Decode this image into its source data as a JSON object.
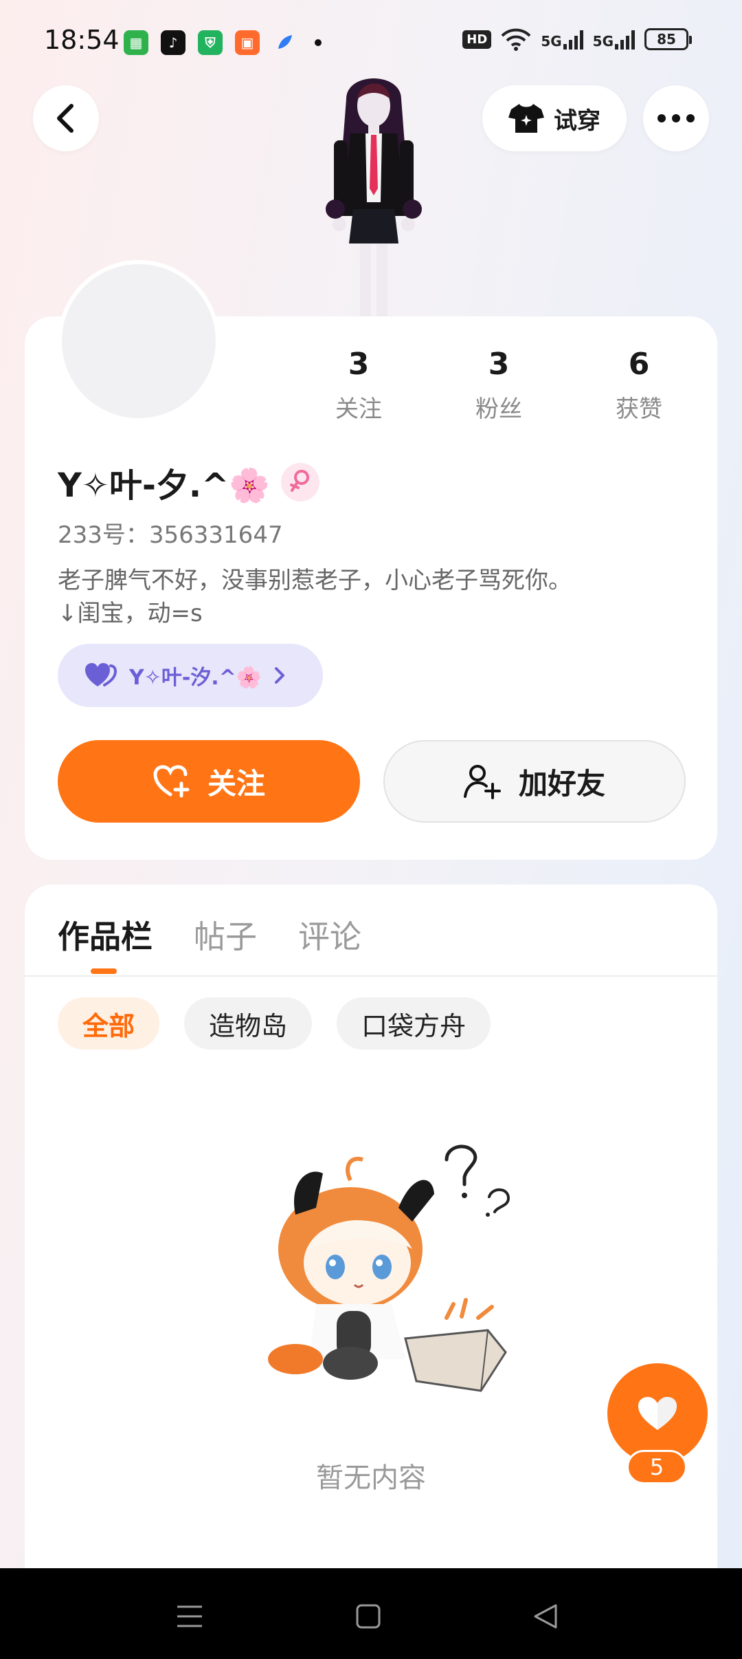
{
  "status_bar": {
    "time": "18:54",
    "hd_badge": "HD",
    "network_1": "5G",
    "network_2": "5G",
    "battery": "85"
  },
  "header": {
    "tryon_label": "试穿"
  },
  "profile": {
    "stats": [
      {
        "value": "3",
        "label": "关注"
      },
      {
        "value": "3",
        "label": "粉丝"
      },
      {
        "value": "6",
        "label": "获赞"
      }
    ],
    "nickname": "Y✧叶-夕.^🌸",
    "uid": "233号：356331647",
    "bio_line1": "老子脾气不好，没事别惹老子，小心老子骂死你。",
    "bio_line2": "↓闺宝，动=s",
    "partner_name": "Y✧叶-汐.^🌸",
    "follow_label": "关注",
    "add_friend_label": "加好友"
  },
  "content": {
    "tabs": [
      "作品栏",
      "帖子",
      "评论"
    ],
    "chips": [
      "全部",
      "造物岛",
      "口袋方舟"
    ],
    "empty_text": "暂无内容"
  },
  "like_fab": {
    "count": "5"
  },
  "colors": {
    "accent": "#ff7414",
    "partner_bg": "#e8e6fb",
    "partner_text": "#6b5fd6",
    "gender_pink": "#f06a9b"
  }
}
